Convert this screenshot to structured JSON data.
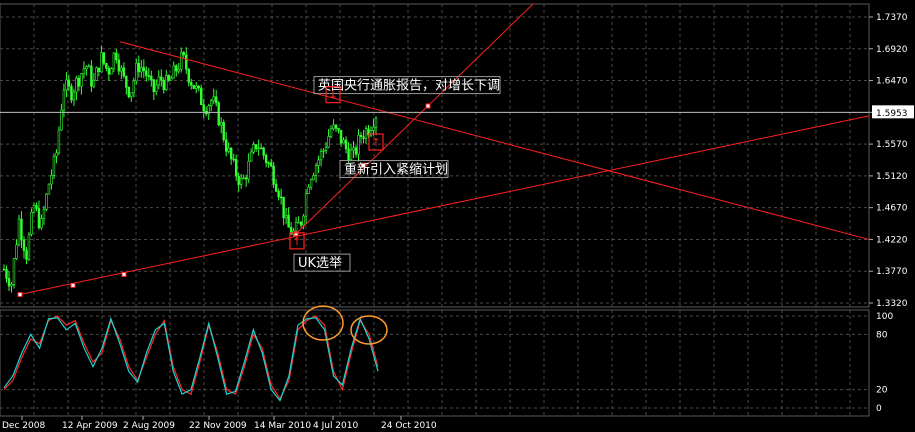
{
  "chart_data": [
    {
      "type": "candlestick",
      "instrument_price_label": "1.5953",
      "ylim": [
        1.332,
        1.737
      ],
      "yticks": [
        "1.7370",
        "1.6920",
        "1.6470",
        "1.6020",
        "1.5570",
        "1.5120",
        "1.4670",
        "1.4220",
        "1.3770",
        "1.3320"
      ],
      "xticks": [
        "Dec 2008",
        "12 Apr 2009",
        "2 Aug 2009",
        "22 Nov 2009",
        "14 Mar 2010",
        "4 Jul 2010",
        "24 Oct 2010"
      ],
      "grid": true,
      "close_path": [
        1.38,
        1.36,
        1.45,
        1.4,
        1.47,
        1.44,
        1.5,
        1.54,
        1.64,
        1.63,
        1.65,
        1.67,
        1.64,
        1.68,
        1.66,
        1.69,
        1.65,
        1.63,
        1.67,
        1.66,
        1.63,
        1.65,
        1.64,
        1.66,
        1.68,
        1.65,
        1.63,
        1.61,
        1.62,
        1.59,
        1.55,
        1.52,
        1.5,
        1.53,
        1.56,
        1.54,
        1.52,
        1.49,
        1.44,
        1.43,
        1.45,
        1.51,
        1.53,
        1.55,
        1.58,
        1.57,
        1.55,
        1.54,
        1.57,
        1.58,
        1.6
      ],
      "annotations": [
        {
          "text": "英国央行通胀报告，对增长下调",
          "price": 1.6342
        },
        {
          "text": "重新引入紧缩计划",
          "price": 1.5153
        },
        {
          "text": "UK选举",
          "price": 1.3828
        }
      ],
      "marker_labels": [
        "↓",
        "↑",
        "↑"
      ]
    },
    {
      "type": "line",
      "indicator": "stochastic",
      "ylim": [
        0,
        100
      ],
      "yticks": [
        "100",
        "80",
        "20",
        "0"
      ],
      "series": [
        {
          "color": "#ff2a2a",
          "values": [
            20,
            30,
            55,
            75,
            70,
            95,
            100,
            90,
            95,
            70,
            50,
            60,
            95,
            75,
            45,
            30,
            55,
            80,
            95,
            45,
            20,
            15,
            50,
            90,
            60,
            20,
            15,
            45,
            80,
            65,
            25,
            10,
            30,
            85,
            95,
            100,
            90,
            40,
            20,
            60,
            95,
            80,
            45
          ]
        },
        {
          "color": "#1fd6d6",
          "values": [
            22,
            35,
            60,
            80,
            65,
            97,
            98,
            85,
            92,
            65,
            45,
            65,
            97,
            70,
            40,
            28,
            60,
            85,
            92,
            40,
            15,
            20,
            55,
            92,
            55,
            15,
            18,
            50,
            85,
            60,
            20,
            8,
            35,
            90,
            97,
            98,
            85,
            35,
            25,
            65,
            97,
            75,
            40
          ]
        }
      ]
    }
  ]
}
